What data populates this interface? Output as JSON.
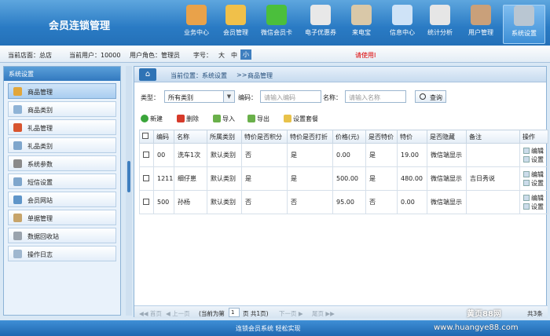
{
  "app": {
    "title": "会员连锁管理"
  },
  "nav": [
    {
      "label": "业务中心",
      "icon": "person-card-icon",
      "color": "#e9a24a"
    },
    {
      "label": "会员管理",
      "icon": "member-chart-icon",
      "color": "#f0c04a"
    },
    {
      "label": "微信会员卡",
      "icon": "wechat-icon",
      "color": "#4bbf3c"
    },
    {
      "label": "电子优惠券",
      "icon": "coupon-icon",
      "color": "#e8e8e8"
    },
    {
      "label": "来电宝",
      "icon": "phone-icon",
      "color": "#d9c8a8"
    },
    {
      "label": "信息中心",
      "icon": "message-icon",
      "color": "#cfe3f7"
    },
    {
      "label": "统计分析",
      "icon": "bar-chart-icon",
      "color": "#e6e6e6"
    },
    {
      "label": "用户管理",
      "icon": "users-icon",
      "color": "#c9a07a"
    },
    {
      "label": "系统设置",
      "icon": "tools-icon",
      "color": "#b9c6d2"
    }
  ],
  "status": {
    "store": "当前店面：总店",
    "user": "当前用户：10000",
    "role": "用户角色：管理员",
    "font_label": "字号：",
    "font_large": "大",
    "font_medium": "中",
    "font_small": "小",
    "notice": "请使用I"
  },
  "sidebar": {
    "title": "系统设置",
    "items": [
      {
        "label": "商品管理",
        "icon": "pencil-icon",
        "color": "#e2a63a"
      },
      {
        "label": "商品类别",
        "icon": "category-icon",
        "color": "#8fb3d6"
      },
      {
        "label": "礼品管理",
        "icon": "gift-icon",
        "color": "#d8552f"
      },
      {
        "label": "礼品类别",
        "icon": "gift-category-icon",
        "color": "#7fa6cc"
      },
      {
        "label": "系统参数",
        "icon": "wrench-icon",
        "color": "#8a8a8a"
      },
      {
        "label": "短信设置",
        "icon": "sms-icon",
        "color": "#7fa6cc"
      },
      {
        "label": "会员网站",
        "icon": "website-icon",
        "color": "#5f95c9"
      },
      {
        "label": "单据管理",
        "icon": "receipt-icon",
        "color": "#c7a46a"
      },
      {
        "label": "数据回收站",
        "icon": "recycle-bin-icon",
        "color": "#9aa3ad"
      },
      {
        "label": "操作日志",
        "icon": "log-icon",
        "color": "#9fb7cf"
      }
    ]
  },
  "breadcrumb": {
    "location": "当前位置：系统设置",
    "sep": ">>",
    "page": "商品管理"
  },
  "filter": {
    "type_label": "类型：",
    "type_value": "所有类别",
    "code_label": "编码：",
    "code_placeholder": "请输入编码",
    "name_label": "名称：",
    "name_placeholder": "请输入名称",
    "query": "查询"
  },
  "toolbar": {
    "new": "新建",
    "delete": "删除",
    "import": "导入",
    "export": "导出",
    "settings": "设置套餐"
  },
  "table": {
    "columns": [
      "编码",
      "名称",
      "所属类别",
      "特价是否积分",
      "特价是否打折",
      "价格(元)",
      "是否特价",
      "特价",
      "是否隐藏",
      "备注",
      "操作"
    ],
    "rows": [
      {
        "code": "00",
        "name": "洗车1次",
        "category": "默认类别",
        "points": "否",
        "discount": "是",
        "price": "0.00",
        "special": "是",
        "special_price": "19.00",
        "hidden": "微信端显示",
        "remark": ""
      },
      {
        "code": "1211",
        "name": "细仔崽",
        "category": "默认类别",
        "points": "是",
        "discount": "是",
        "price": "500.00",
        "special": "是",
        "special_price": "480.00",
        "hidden": "微信端显示",
        "remark": "吉日秀说"
      },
      {
        "code": "500",
        "name": "孙杨",
        "category": "默认类别",
        "points": "否",
        "discount": "否",
        "price": "95.00",
        "special": "否",
        "special_price": "0.00",
        "hidden": "微信端显示",
        "remark": ""
      }
    ],
    "op_edit": "编辑",
    "op_set": "设置"
  },
  "pager": {
    "first": "首页",
    "prev": "上一页",
    "current_prefix": "(当前为第",
    "page": "1",
    "suffix": "页 共1页)",
    "next": "下一页",
    "last": "尾页",
    "total": "共3条"
  },
  "footer": {
    "text": "连锁会员系统 轻松实现"
  },
  "watermark": {
    "line1": "黄页88网",
    "line2": "www.huangye88.com"
  }
}
